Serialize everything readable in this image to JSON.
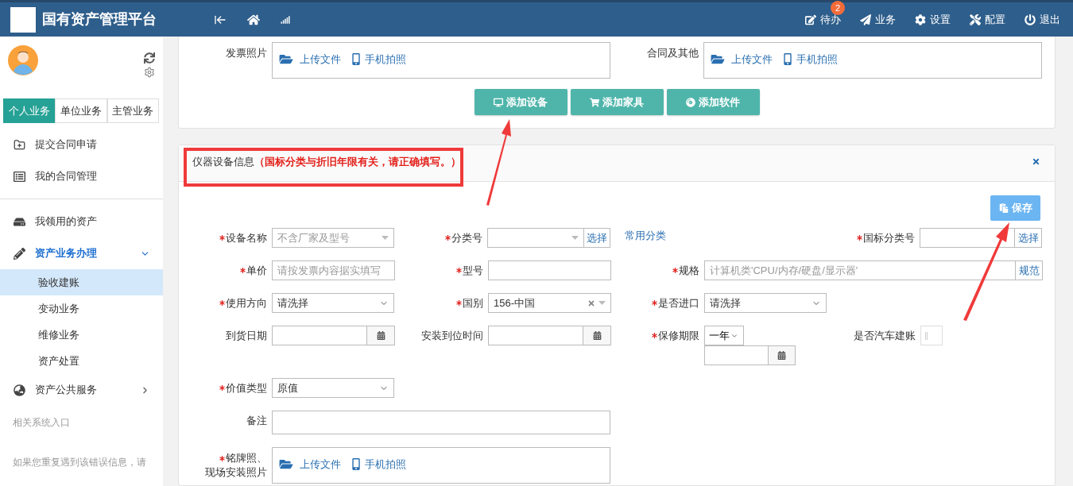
{
  "header": {
    "title": "国有资产管理平台",
    "nav": [
      {
        "label": "待办",
        "badge": "2"
      },
      {
        "label": "业务"
      },
      {
        "label": "设置"
      },
      {
        "label": "配置"
      },
      {
        "label": "退出"
      }
    ]
  },
  "sidebar": {
    "tabs": [
      {
        "label": "个人业务",
        "selected": true
      },
      {
        "label": "单位业务",
        "selected": false
      },
      {
        "label": "主管业务",
        "selected": false
      }
    ],
    "sections": [
      [
        {
          "label": "提交合同申请",
          "selected": false
        },
        {
          "label": "我的合同管理",
          "selected": false
        }
      ],
      [
        {
          "label": "我领用的资产",
          "selected": false
        },
        {
          "label": "资产业务办理",
          "selected": true,
          "expanded": true,
          "children": [
            {
              "label": "验收建账",
              "selected": true
            },
            {
              "label": "变动业务",
              "selected": false
            },
            {
              "label": "维修业务",
              "selected": false
            },
            {
              "label": "资产处置",
              "selected": false
            }
          ]
        },
        {
          "label": "资产公共服务",
          "selected": false,
          "expanded": false
        }
      ]
    ],
    "related_title": "相关系统入口",
    "notice": "如果您重复遇到该错误信息，请"
  },
  "attachments": {
    "fields": [
      {
        "label": "发票照片",
        "actions": [
          "上传文件",
          "手机拍照"
        ]
      },
      {
        "label": "合同及其他",
        "actions": [
          "上传文件",
          "手机拍照"
        ]
      }
    ],
    "buttons": [
      "添加设备",
      "添加家具",
      "添加软件"
    ]
  },
  "equipment": {
    "title": "仪器设备信息",
    "note": "（国标分类与折旧年限有关，请正确填写。）",
    "save": "保存",
    "rows": [
      [
        {
          "kind": "dropdown",
          "label": "设备名称",
          "required": true,
          "placeholder": "不含厂家及型号"
        },
        {
          "kind": "pick-select",
          "label": "分类号",
          "required": true,
          "button": "选择"
        },
        {
          "kind": "link",
          "text": "常用分类"
        },
        {
          "kind": "pick",
          "label": "国标分类号",
          "required": true,
          "button": "选择"
        }
      ],
      [
        {
          "kind": "text",
          "label": "单价",
          "required": true,
          "placeholder": "请按发票内容据实填写"
        },
        {
          "kind": "text",
          "label": "型号",
          "required": true
        },
        {
          "kind": "spec",
          "label": "规格",
          "required": true,
          "placeholder": "计算机类'CPU/内存/硬盘/显示器'",
          "button": "规范"
        }
      ],
      [
        {
          "kind": "select",
          "label": "使用方向",
          "required": true,
          "value": "请洗择"
        },
        {
          "kind": "combo",
          "label": "国别",
          "required": true,
          "value": "156-中国"
        },
        {
          "kind": "select",
          "label": "是否进口",
          "required": true,
          "value": "请洗择"
        }
      ],
      [
        {
          "kind": "date",
          "label": "到货日期",
          "required": false
        },
        {
          "kind": "date",
          "label": "安装到位时间",
          "required": false
        },
        {
          "kind": "warranty",
          "label": "保修期限",
          "required": true,
          "value": "一年"
        },
        {
          "kind": "toggle",
          "label": "是否汽车建账",
          "required": false,
          "on": false
        }
      ],
      [
        {
          "kind": "select",
          "label": "价值类型",
          "required": true,
          "value": "原值"
        }
      ],
      [
        {
          "kind": "textarea",
          "label": "备注",
          "required": false
        }
      ],
      [
        {
          "kind": "upload",
          "label_lines": [
            "铭牌照、",
            "现场安装照片"
          ],
          "required": true,
          "actions": [
            "上传文件",
            "手机拍照"
          ]
        }
      ]
    ]
  }
}
